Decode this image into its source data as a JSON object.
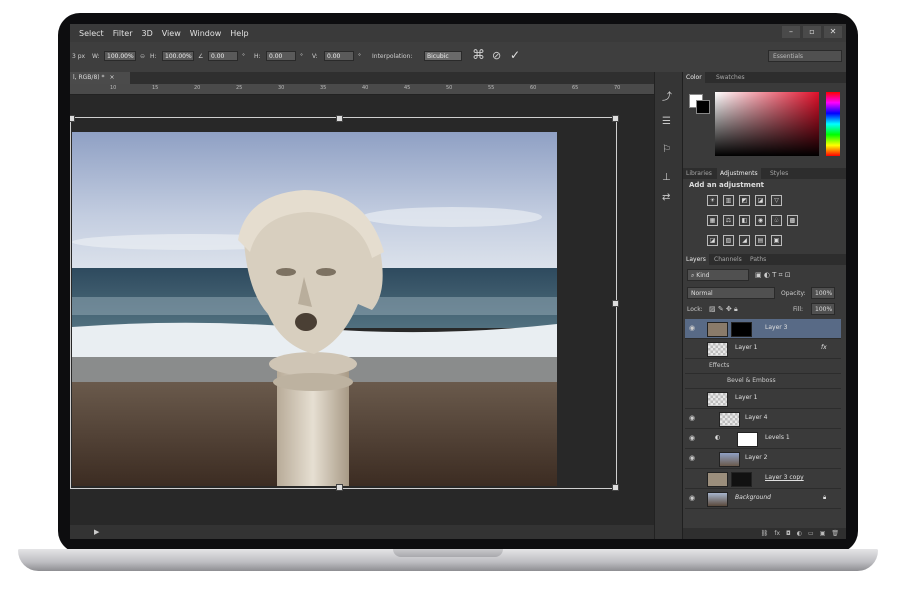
{
  "menu": [
    "Select",
    "Filter",
    "3D",
    "View",
    "Window",
    "Help"
  ],
  "window_controls": [
    "–",
    "▫",
    "✕"
  ],
  "options_bar": {
    "x_value": "3 px",
    "w_label": "W:",
    "w_value": "100.00%",
    "h_label": "H:",
    "h_value": "100.00%",
    "angle_value": "0.00",
    "deg": "°",
    "hskew_label": "H:",
    "hskew_value": "0.00",
    "vskew_label": "V:",
    "vskew_value": "0.00",
    "interpolation_label": "Interpolation:",
    "interpolation_value": "Bicubic",
    "workspace": "Essentials"
  },
  "document_tab": "l, RGB/8) *",
  "ruler_ticks": [
    "10",
    "15",
    "20",
    "25",
    "30",
    "35",
    "40",
    "45",
    "50",
    "55",
    "60",
    "65",
    "70"
  ],
  "color_panel": {
    "tabs": [
      "Color",
      "Swatches"
    ],
    "fg_color": "#ffffff",
    "bg_color": "#000000",
    "picked_hue": "#e0102a"
  },
  "adjustments_panel": {
    "tabs": [
      "Libraries",
      "Adjustments",
      "Styles"
    ],
    "title": "Add an adjustment"
  },
  "layers_panel": {
    "tabs": [
      "Layers",
      "Channels",
      "Paths"
    ],
    "filter": "Kind",
    "blend_mode": "Normal",
    "opacity_label": "Opacity:",
    "opacity_value": "100%",
    "lock_label": "Lock:",
    "fill_label": "Fill:",
    "fill_value": "100%",
    "layers": [
      {
        "name": "Layer 3",
        "selected": true
      },
      {
        "name": "Layer 1",
        "fx": "fx"
      },
      {
        "name": "Layer 1"
      },
      {
        "name": "Layer 4"
      },
      {
        "name": "Levels 1"
      },
      {
        "name": "Layer 2"
      },
      {
        "name": "Layer 3 copy"
      },
      {
        "name": "Background"
      }
    ],
    "effects_label": "Effects",
    "effect_name": "Bevel & Emboss"
  }
}
